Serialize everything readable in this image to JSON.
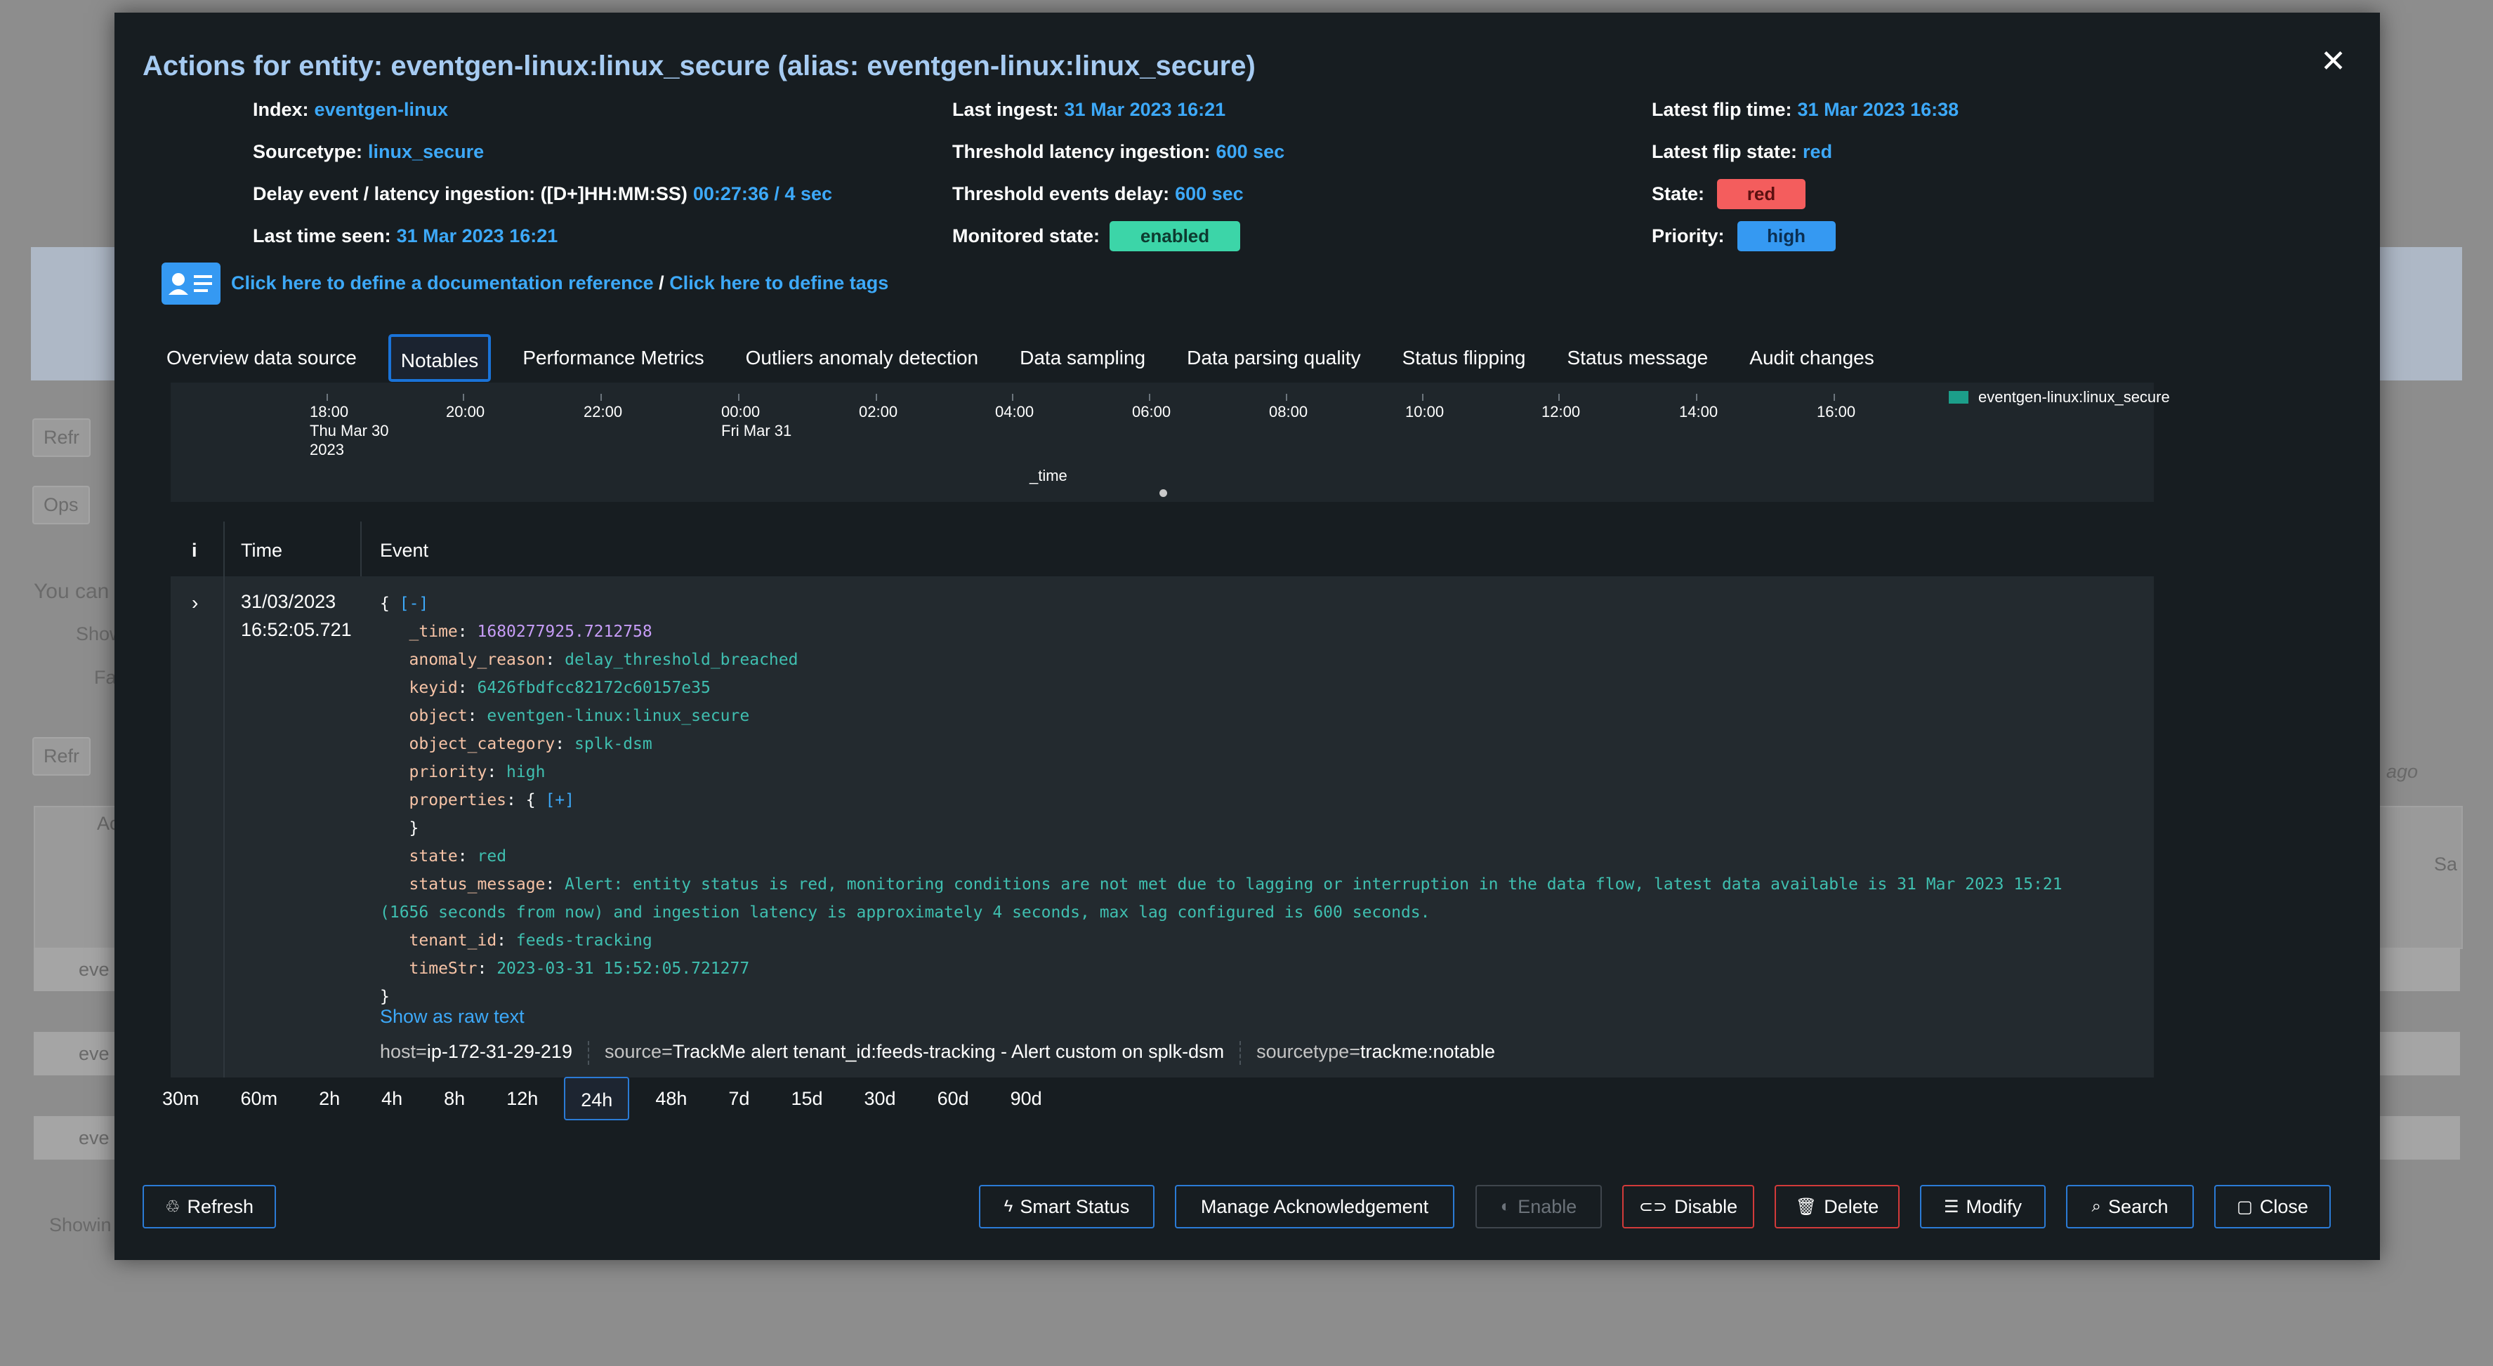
{
  "background": {
    "buttons": [
      "Refr",
      "Ops",
      "Refr"
    ],
    "texts": [
      "You can",
      "Show",
      "Fa",
      "ago",
      "Ac",
      "Sa",
      "eve",
      "eve",
      "eve",
      "Showin"
    ]
  },
  "modal": {
    "title": "Actions for entity: eventgen-linux:linux_secure (alias: eventgen-linux:linux_secure)",
    "close_glyph": "✕",
    "info": {
      "col1": [
        {
          "label": "Index:",
          "value": "eventgen-linux"
        },
        {
          "label": "Sourcetype:",
          "value": "linux_secure"
        },
        {
          "label": "Delay event / latency ingestion: ([D+]HH:MM:SS)",
          "value": "00:27:36 / 4 sec"
        },
        {
          "label": "Last time seen:",
          "value": "31 Mar 2023 16:21"
        }
      ],
      "col2": [
        {
          "label": "Last ingest:",
          "value": "31 Mar 2023 16:21"
        },
        {
          "label": "Threshold latency ingestion:",
          "value": "600 sec"
        },
        {
          "label": "Threshold events delay:",
          "value": "600 sec"
        },
        {
          "label": "Monitored state:",
          "value": "enabled"
        }
      ],
      "col3": [
        {
          "label": "Latest flip time:",
          "value": "31 Mar 2023 16:38"
        },
        {
          "label": "Latest flip state:",
          "value": "red"
        },
        {
          "label": "State:",
          "value": "red"
        },
        {
          "label": "Priority:",
          "value": "high"
        }
      ]
    },
    "doc_link": "Click here to define a documentation reference",
    "doc_sep": " / ",
    "tags_link": "Click here to define tags",
    "tabs": [
      {
        "label": "Overview data source"
      },
      {
        "label": "Notables",
        "active": true
      },
      {
        "label": "Performance Metrics"
      },
      {
        "label": "Outliers anomaly detection"
      },
      {
        "label": "Data sampling"
      },
      {
        "label": "Data parsing quality"
      },
      {
        "label": "Status flipping"
      },
      {
        "label": "Status message"
      },
      {
        "label": "Audit changes"
      }
    ],
    "chart": {
      "ticks": [
        {
          "label": "18:00",
          "sub1": "Thu Mar 30",
          "sub2": "2023"
        },
        {
          "label": "20:00"
        },
        {
          "label": "22:00"
        },
        {
          "label": "00:00",
          "sub1": "Fri Mar 31"
        },
        {
          "label": "02:00"
        },
        {
          "label": "04:00"
        },
        {
          "label": "06:00"
        },
        {
          "label": "08:00"
        },
        {
          "label": "10:00"
        },
        {
          "label": "12:00"
        },
        {
          "label": "14:00"
        },
        {
          "label": "16:00"
        }
      ],
      "xlabel": "_time",
      "legend": "eventgen-linux:linux_secure",
      "legend_color": "#1c9e8a"
    },
    "events": {
      "headers": {
        "info": "i",
        "time": "Time",
        "event": "Event"
      },
      "expander": "›",
      "time_line1": "31/03/2023",
      "time_line2": "16:52:05.721",
      "open_brace": "{",
      "collapse_toggle": "[-]",
      "close_brace": "}",
      "fields": [
        {
          "key": "_time",
          "value": "1680277925.7212758",
          "type": "num"
        },
        {
          "key": "anomaly_reason",
          "value": "delay_threshold_breached"
        },
        {
          "key": "keyid",
          "value": "6426fbdfcc82172c60157e35"
        },
        {
          "key": "object",
          "value": "eventgen-linux:linux_secure"
        },
        {
          "key": "object_category",
          "value": "splk-dsm"
        },
        {
          "key": "priority",
          "value": "high"
        }
      ],
      "properties": {
        "key": "properties",
        "open": "{",
        "toggle": "[+]",
        "close": "}"
      },
      "state": {
        "key": "state",
        "value": "red"
      },
      "status_message": {
        "key": "status_message",
        "line1": "Alert: entity status is red, monitoring conditions are not met due to lagging or interruption in the data flow, latest data available is 31 Mar 2023 15:21",
        "line2": "(1656 seconds from now) and ingestion latency is approximately 4 seconds, max lag configured is 600 seconds."
      },
      "tail_fields": [
        {
          "key": "tenant_id",
          "value": "feeds-tracking"
        },
        {
          "key": "timeStr",
          "value": "2023-03-31 15:52:05.721277"
        }
      ],
      "raw_link": "Show as raw text",
      "meta": [
        {
          "name": "host",
          "value": "ip-172-31-29-219"
        },
        {
          "name": "source",
          "value": "TrackMe alert tenant_id:feeds-tracking - Alert custom on splk-dsm"
        },
        {
          "name": "sourcetype",
          "value": "trackme:notable"
        }
      ],
      "meta_eq": " = "
    },
    "ranges": [
      {
        "label": "30m"
      },
      {
        "label": "60m"
      },
      {
        "label": "2h"
      },
      {
        "label": "4h"
      },
      {
        "label": "8h"
      },
      {
        "label": "12h"
      },
      {
        "label": "24h",
        "selected": true
      },
      {
        "label": "48h"
      },
      {
        "label": "7d"
      },
      {
        "label": "15d"
      },
      {
        "label": "30d"
      },
      {
        "label": "60d"
      },
      {
        "label": "90d"
      }
    ],
    "buttons": {
      "refresh": "Refresh",
      "smart_status": "Smart Status",
      "manage_ack": "Manage Acknowledgement",
      "enable": "Enable",
      "disable": "Disable",
      "delete": "Delete",
      "modify": "Modify",
      "search": "Search",
      "close": "Close"
    },
    "colors": {
      "link": "#3da9f9",
      "accent_border": "#2b7bd6",
      "danger_border": "#d23a3a",
      "state_red": "#f45d5d",
      "enabled_green": "#3cd5a8",
      "priority_blue": "#3599f2"
    }
  }
}
